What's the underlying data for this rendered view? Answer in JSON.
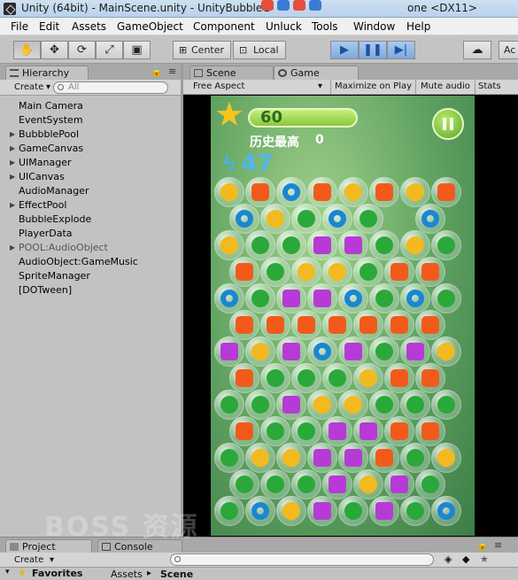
{
  "window": {
    "title": "Unity (64bit) - MainScene.unity - UnityBubbleG",
    "title_tail": "one <DX11>"
  },
  "menu": [
    "File",
    "Edit",
    "Assets",
    "GameObject",
    "Component",
    "Unluck",
    "Tools",
    "Window",
    "Help"
  ],
  "toolbar": {
    "tools": [
      "hand-tool",
      "move-tool",
      "rotate-tool",
      "scale-tool",
      "rect-tool"
    ],
    "pivot_label": "Center",
    "space_label": "Local",
    "playback": [
      "play",
      "pause",
      "step"
    ],
    "right_label": "Ac"
  },
  "hierarchy": {
    "tab_label": "Hierarchy",
    "create_label": "Create",
    "search_placeholder": "All",
    "items": [
      {
        "label": "Main Camera",
        "expandable": false,
        "dim": false
      },
      {
        "label": "EventSystem",
        "expandable": false,
        "dim": false
      },
      {
        "label": "BubbblePool",
        "expandable": true,
        "dim": false
      },
      {
        "label": "GameCanvas",
        "expandable": true,
        "dim": false
      },
      {
        "label": "UIManager",
        "expandable": true,
        "dim": false
      },
      {
        "label": "UICanvas",
        "expandable": true,
        "dim": false
      },
      {
        "label": "AudioManager",
        "expandable": false,
        "dim": false
      },
      {
        "label": "EffectPool",
        "expandable": true,
        "dim": false
      },
      {
        "label": "BubbleExplode",
        "expandable": false,
        "dim": false
      },
      {
        "label": "PlayerData",
        "expandable": false,
        "dim": false
      },
      {
        "label": "POOL:AudioObject",
        "expandable": true,
        "dim": true
      },
      {
        "label": "AudioObject:GameMusic",
        "expandable": false,
        "dim": false
      },
      {
        "label": "SpriteManager",
        "expandable": false,
        "dim": false
      },
      {
        "label": "[DOTween]",
        "expandable": false,
        "dim": false
      }
    ]
  },
  "game_view": {
    "scene_tab": "Scene",
    "game_tab": "Game",
    "aspect": "Free Aspect",
    "maximize": "Maximize on Play",
    "mute": "Mute audio",
    "stats": "Stats",
    "hud": {
      "score": "60",
      "best_label": "历史最高",
      "best_value": "0",
      "shots": "47"
    },
    "colors": {
      "orange": "#f25a1c",
      "green": "#2aa83a",
      "purple": "#b73ad6",
      "blue": "#1b86d4",
      "yellow": "#f3b920"
    }
  },
  "bottom": {
    "project_tab": "Project",
    "console_tab": "Console",
    "create_label": "Create",
    "favorites": "Favorites",
    "breadcrumb": [
      "Assets",
      "Scene"
    ]
  },
  "watermark": "BOSS 资源"
}
